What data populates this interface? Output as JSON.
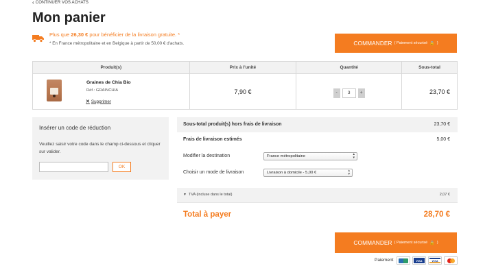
{
  "nav": {
    "back_label": "CONTINUER VOS ACHATS"
  },
  "page_title": "Mon panier",
  "shipping_promo": {
    "prefix": "Plus que ",
    "amount": "26,30 €",
    "suffix": " pour bénéficier de la livraison gratuite. *",
    "note": "* En France métropolitaine et en Belgique à partir de 50,00 € d'achats.",
    "icon": "truck-icon"
  },
  "order_button": {
    "label": "COMMANDER",
    "sublabel": "( Paiement sécurisé",
    "lock_icon": "lock-icon",
    "close_paren": ")"
  },
  "cart_table": {
    "headers": [
      "Produit(s)",
      "Prix à l'unité",
      "Quantité",
      "Sous-total"
    ],
    "rows": [
      {
        "name": "Graines de Chia Bio",
        "ref": "Réf.: GRAINCHIA",
        "remove_label": "Supprimer",
        "unit_price": "7,90 €",
        "quantity": "3",
        "minus": "-",
        "plus": "+",
        "subtotal": "23,70 €"
      }
    ]
  },
  "discount": {
    "title": "Insérer un code de réduction",
    "text": "Veuillez saisir votre code dans le champ ci-dessous et cliquer sur valider.",
    "input_value": "",
    "ok_label": "OK"
  },
  "summary": {
    "subtotal_label": "Sous-total produit(s) hors frais de livraison",
    "subtotal_value": "23,70 €",
    "shipping_label": "Frais de livraison estimés",
    "shipping_value": "5,00 €",
    "destination_label": "Modifier la destination",
    "destination_value": "France métropolitaine",
    "mode_label": "Choisir un mode de livraison",
    "mode_value": "Livraison à domicile - 5,00 €",
    "tva_label": "TVA (incluse dans le total)",
    "tva_value": "2,07 €",
    "total_label": "Total à payer",
    "total_value": "28,70 €"
  },
  "payment": {
    "label": "Paiement",
    "cards": [
      "cb-card-icon",
      "visa-card-icon",
      "visa-electron-card-icon",
      "mastercard-icon"
    ],
    "visa_text": "VISA"
  },
  "colors": {
    "accent": "#f47c20",
    "panel": "#f2f2f2",
    "border": "#d8d8d8"
  }
}
